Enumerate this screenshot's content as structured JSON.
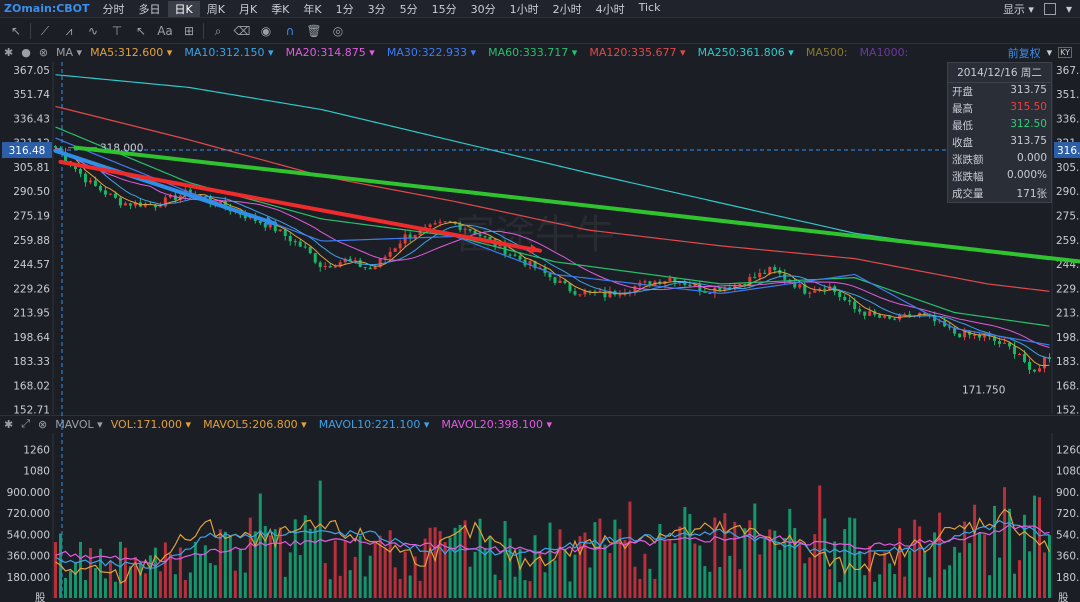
{
  "topbar": {
    "symbol": "ZOmain:CBOT",
    "periods": [
      "分时",
      "多日",
      "日K",
      "周K",
      "月K",
      "季K",
      "年K",
      "1分",
      "3分",
      "5分",
      "15分",
      "30分",
      "1小时",
      "2小时",
      "4小时",
      "Tick"
    ],
    "active_period": "日K",
    "display_label": "显示",
    "window_controls": [
      "checkbox-icon",
      "minimize-icon"
    ]
  },
  "toolbar": {
    "tools": [
      "cursor-icon",
      "line-icon",
      "polyline-icon",
      "wave-icon",
      "hline-icon",
      "arrow-icon",
      "text-icon",
      "ruler-icon",
      "magnet-icon",
      "zoom-icon",
      "eraser-icon",
      "eye-icon",
      "lock-icon",
      "trash-icon",
      "layers-icon"
    ],
    "text_tool_label": "Aa"
  },
  "ma_legend": {
    "name": "MA",
    "items": [
      {
        "label": "MA5:312.600",
        "color": "#e0a23a"
      },
      {
        "label": "MA10:312.150",
        "color": "#3da2e6"
      },
      {
        "label": "MA20:314.875",
        "color": "#e05ce0"
      },
      {
        "label": "MA30:322.933",
        "color": "#3d7cf0"
      },
      {
        "label": "MA60:333.717",
        "color": "#27c06b"
      },
      {
        "label": "MA120:335.677",
        "color": "#e04a4a"
      },
      {
        "label": "MA250:361.806",
        "color": "#2ec8c8"
      },
      {
        "label": "MA500:",
        "color": "#8a7a2a"
      },
      {
        "label": "MA1000:",
        "color": "#6a3a9a"
      }
    ],
    "adjust_label": "前复权"
  },
  "vol_legend": {
    "name": "MAVOL",
    "items": [
      {
        "label": "VOL:171.000",
        "color": "#e0a23a"
      },
      {
        "label": "MAVOL5:206.800",
        "color": "#e0a23a"
      },
      {
        "label": "MAVOL10:221.100",
        "color": "#3da2e6"
      },
      {
        "label": "MAVOL20:398.100",
        "color": "#e05ce0"
      }
    ]
  },
  "infobox": {
    "date": "2014/12/16 周二",
    "rows": [
      {
        "k": "开盘",
        "v": "313.75",
        "color": "#c8ccd4"
      },
      {
        "k": "最高",
        "v": "315.50",
        "color": "#f03c3c"
      },
      {
        "k": "最低",
        "v": "312.50",
        "color": "#2cd07a"
      },
      {
        "k": "收盘",
        "v": "313.75",
        "color": "#c8ccd4"
      },
      {
        "k": "涨跌额",
        "v": "0.000",
        "color": "#c8ccd4"
      },
      {
        "k": "涨跌幅",
        "v": "0.000%",
        "color": "#c8ccd4"
      },
      {
        "k": "成交量",
        "v": "171张",
        "color": "#c8ccd4"
      }
    ]
  },
  "chart_data": [
    {
      "type": "candlestick",
      "price_axis_ticks": [
        "367.05",
        "351.74",
        "336.43",
        "321.12",
        "305.81",
        "290.50",
        "275.19",
        "259.88",
        "244.57",
        "229.26",
        "213.95",
        "198.64",
        "183.33",
        "168.02",
        "152.71"
      ],
      "price_axis_tick_values": [
        367.05,
        351.74,
        336.43,
        321.12,
        305.81,
        290.5,
        275.19,
        259.88,
        244.57,
        229.26,
        213.95,
        198.64,
        183.33,
        168.02,
        152.71
      ],
      "ylim": [
        150,
        372
      ],
      "crosshair_price": "316.48",
      "crosshair_price_value": 316.48,
      "annotations": [
        {
          "text": "318.000",
          "value": 318.0
        },
        {
          "text": "171.750",
          "value": 171.75
        }
      ],
      "n_bars": 200,
      "close_path": [
        [
          0,
          318
        ],
        [
          10,
          296
        ],
        [
          20,
          283
        ],
        [
          30,
          282
        ],
        [
          40,
          290
        ],
        [
          55,
          277
        ],
        [
          65,
          268
        ],
        [
          75,
          254
        ],
        [
          80,
          243
        ],
        [
          87,
          247
        ],
        [
          95,
          241
        ],
        [
          105,
          262
        ],
        [
          118,
          271
        ],
        [
          125,
          266
        ],
        [
          135,
          253
        ],
        [
          145,
          241
        ],
        [
          155,
          228
        ],
        [
          165,
          225
        ],
        [
          175,
          231
        ],
        [
          185,
          236
        ],
        [
          195,
          228
        ],
        [
          205,
          232
        ],
        [
          215,
          241
        ],
        [
          225,
          228
        ],
        [
          232,
          231
        ],
        [
          240,
          216
        ],
        [
          250,
          209
        ],
        [
          260,
          213
        ],
        [
          270,
          201
        ],
        [
          280,
          198
        ],
        [
          290,
          188
        ],
        [
          293,
          173
        ],
        [
          297,
          185
        ],
        [
          300,
          188
        ]
      ],
      "ma_paths": {
        "MA250": [
          [
            0,
            364
          ],
          [
            40,
            356
          ],
          [
            80,
            342
          ],
          [
            120,
            322
          ],
          [
            160,
            302
          ],
          [
            200,
            283
          ],
          [
            240,
            264
          ],
          [
            280,
            252
          ],
          [
            300,
            247
          ]
        ],
        "MA120": [
          [
            0,
            344
          ],
          [
            40,
            323
          ],
          [
            80,
            300
          ],
          [
            120,
            284
          ],
          [
            160,
            266
          ],
          [
            200,
            256
          ],
          [
            240,
            248
          ],
          [
            280,
            232
          ],
          [
            300,
            227
          ]
        ],
        "MA60": [
          [
            0,
            331
          ],
          [
            40,
            296
          ],
          [
            80,
            273
          ],
          [
            120,
            262
          ],
          [
            150,
            246
          ],
          [
            200,
            232
          ],
          [
            240,
            236
          ],
          [
            270,
            214
          ],
          [
            300,
            205
          ]
        ],
        "MA30": [
          [
            0,
            324
          ],
          [
            40,
            290
          ],
          [
            80,
            259
          ],
          [
            120,
            262
          ],
          [
            150,
            238
          ],
          [
            200,
            226
          ],
          [
            240,
            238
          ],
          [
            270,
            204
          ],
          [
            300,
            193
          ]
        ]
      },
      "trend_arrows": [
        {
          "color": "#2f8fe8",
          "from": [
            0,
            316
          ],
          "to": [
            44,
            270
          ]
        },
        {
          "color": "#ef2b2b",
          "from": [
            1,
            309
          ],
          "to": [
            97,
            253
          ]
        },
        {
          "color": "#2fc42f",
          "from": [
            4,
            318
          ],
          "to": [
            214,
            243
          ]
        }
      ],
      "watermark": "富途牛牛"
    },
    {
      "type": "bar",
      "volume_axis_ticks": [
        "1260",
        "1080",
        "900.000",
        "720.000",
        "540.000",
        "360.000",
        "180.000"
      ],
      "volume_axis_tick_values": [
        1260,
        1080,
        900,
        720,
        540,
        360,
        180
      ],
      "ylim": [
        0,
        1400
      ],
      "bottom_label": "股",
      "mavol_paths": {
        "MAVOL5": [
          [
            0,
            260
          ],
          [
            20,
            170
          ],
          [
            30,
            330
          ],
          [
            45,
            600
          ],
          [
            60,
            470
          ],
          [
            80,
            610
          ],
          [
            95,
            490
          ],
          [
            110,
            330
          ],
          [
            125,
            580
          ],
          [
            140,
            290
          ],
          [
            160,
            450
          ],
          [
            180,
            540
          ],
          [
            200,
            580
          ],
          [
            220,
            500
          ],
          [
            235,
            270
          ],
          [
            250,
            330
          ],
          [
            265,
            520
          ],
          [
            285,
            700
          ],
          [
            300,
            380
          ]
        ],
        "MAVOL10": [
          [
            0,
            320
          ],
          [
            30,
            260
          ],
          [
            45,
            520
          ],
          [
            70,
            560
          ],
          [
            95,
            540
          ],
          [
            110,
            410
          ],
          [
            140,
            380
          ],
          [
            170,
            500
          ],
          [
            200,
            560
          ],
          [
            235,
            380
          ],
          [
            260,
            420
          ],
          [
            285,
            640
          ],
          [
            300,
            520
          ]
        ],
        "MAVOL20": [
          [
            0,
            380
          ],
          [
            30,
            300
          ],
          [
            60,
            460
          ],
          [
            90,
            480
          ],
          [
            120,
            430
          ],
          [
            150,
            400
          ],
          [
            180,
            470
          ],
          [
            210,
            520
          ],
          [
            240,
            430
          ],
          [
            270,
            500
          ],
          [
            290,
            620
          ],
          [
            300,
            560
          ]
        ]
      }
    }
  ]
}
